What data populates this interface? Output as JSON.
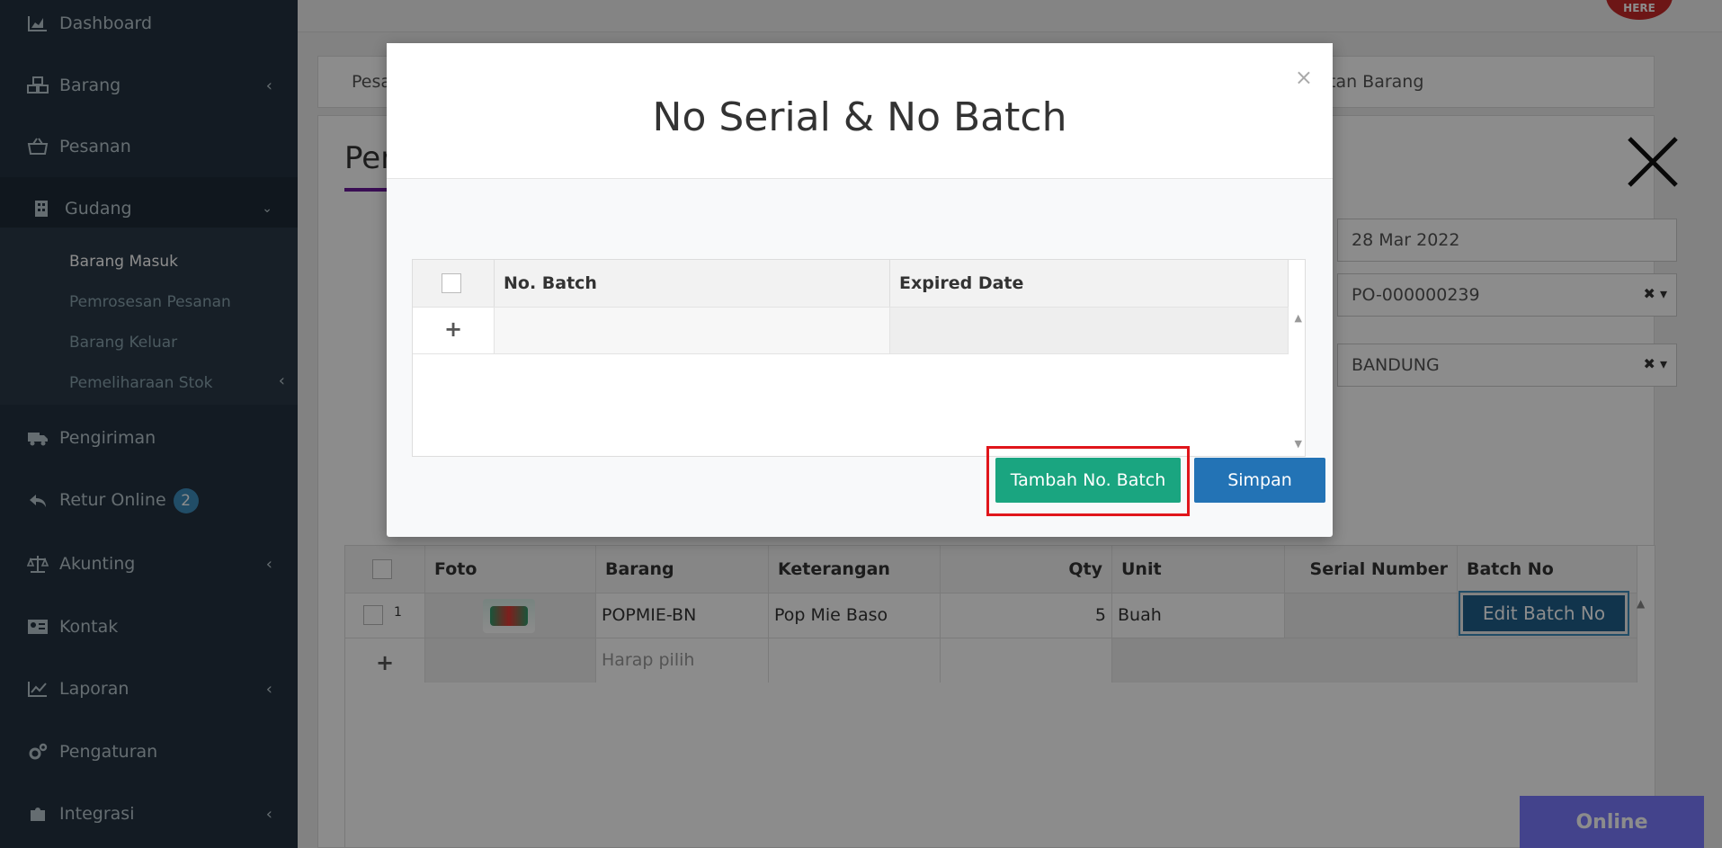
{
  "sidebar": {
    "items": [
      {
        "label": "Dashboard",
        "icon": "chart-area-icon"
      },
      {
        "label": "Barang",
        "icon": "cubes-icon"
      },
      {
        "label": "Pesanan",
        "icon": "basket-icon"
      },
      {
        "label": "Gudang",
        "icon": "building-icon"
      },
      {
        "label": "Pengiriman",
        "icon": "truck-icon"
      },
      {
        "label": "Retur Online",
        "icon": "reply-icon",
        "badge": "2"
      },
      {
        "label": "Akunting",
        "icon": "balance-scale-icon"
      },
      {
        "label": "Kontak",
        "icon": "address-card-icon"
      },
      {
        "label": "Laporan",
        "icon": "line-chart-icon"
      },
      {
        "label": "Pengaturan",
        "icon": "gears-icon"
      },
      {
        "label": "Integrasi",
        "icon": "puzzle-icon"
      }
    ],
    "submenu": [
      "Barang Masuk",
      "Pemrosesan Pesanan",
      "Barang Keluar",
      "Pemeliharaan Stok"
    ]
  },
  "tabs": {
    "left": "Pesa",
    "right": "tan Barang"
  },
  "panel": {
    "title": "Per"
  },
  "fields": {
    "date": "28 Mar 2022",
    "po": "PO-000000239",
    "warehouse": "BANDUNG"
  },
  "grid": {
    "headers": [
      "Foto",
      "Barang",
      "Keterangan",
      "Qty",
      "Unit",
      "Serial Number",
      "Batch No"
    ],
    "row": {
      "num": "1",
      "barang": "POPMIE-BN",
      "keterangan": "Pop Mie Baso",
      "qty": "5",
      "unit": "Buah",
      "action": "Edit Batch No"
    },
    "placeholder": "Harap pilih"
  },
  "online_label": "Online",
  "modal": {
    "title": "No Serial & No Batch",
    "close": "×",
    "headers": [
      "No. Batch",
      "Expired Date"
    ],
    "add_button": "Tambah No. Batch",
    "save_button": "Simpan"
  },
  "colors": {
    "sidebar": "#243240",
    "primary": "#2373b5",
    "success": "#1aa580",
    "highlight": "#e0161b"
  }
}
